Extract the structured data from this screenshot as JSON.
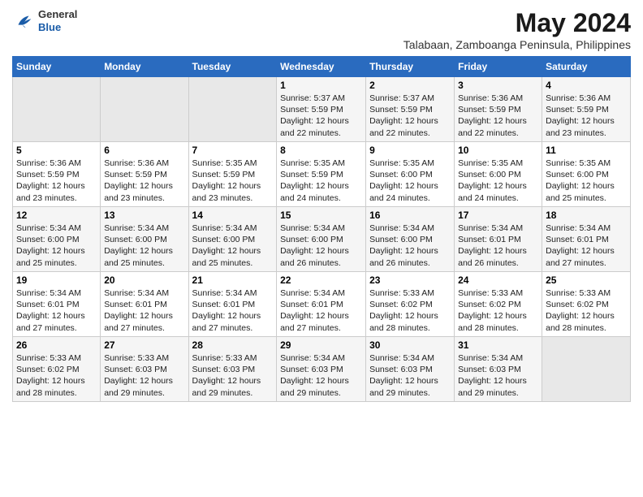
{
  "header": {
    "logo": {
      "line1": "General",
      "line2": "Blue"
    },
    "month_year": "May 2024",
    "location": "Talabaan, Zamboanga Peninsula, Philippines"
  },
  "days_of_week": [
    "Sunday",
    "Monday",
    "Tuesday",
    "Wednesday",
    "Thursday",
    "Friday",
    "Saturday"
  ],
  "weeks": [
    [
      {
        "day": "",
        "content": ""
      },
      {
        "day": "",
        "content": ""
      },
      {
        "day": "",
        "content": ""
      },
      {
        "day": "1",
        "content": "Sunrise: 5:37 AM\nSunset: 5:59 PM\nDaylight: 12 hours\nand 22 minutes."
      },
      {
        "day": "2",
        "content": "Sunrise: 5:37 AM\nSunset: 5:59 PM\nDaylight: 12 hours\nand 22 minutes."
      },
      {
        "day": "3",
        "content": "Sunrise: 5:36 AM\nSunset: 5:59 PM\nDaylight: 12 hours\nand 22 minutes."
      },
      {
        "day": "4",
        "content": "Sunrise: 5:36 AM\nSunset: 5:59 PM\nDaylight: 12 hours\nand 23 minutes."
      }
    ],
    [
      {
        "day": "5",
        "content": "Sunrise: 5:36 AM\nSunset: 5:59 PM\nDaylight: 12 hours\nand 23 minutes."
      },
      {
        "day": "6",
        "content": "Sunrise: 5:36 AM\nSunset: 5:59 PM\nDaylight: 12 hours\nand 23 minutes."
      },
      {
        "day": "7",
        "content": "Sunrise: 5:35 AM\nSunset: 5:59 PM\nDaylight: 12 hours\nand 23 minutes."
      },
      {
        "day": "8",
        "content": "Sunrise: 5:35 AM\nSunset: 5:59 PM\nDaylight: 12 hours\nand 24 minutes."
      },
      {
        "day": "9",
        "content": "Sunrise: 5:35 AM\nSunset: 6:00 PM\nDaylight: 12 hours\nand 24 minutes."
      },
      {
        "day": "10",
        "content": "Sunrise: 5:35 AM\nSunset: 6:00 PM\nDaylight: 12 hours\nand 24 minutes."
      },
      {
        "day": "11",
        "content": "Sunrise: 5:35 AM\nSunset: 6:00 PM\nDaylight: 12 hours\nand 25 minutes."
      }
    ],
    [
      {
        "day": "12",
        "content": "Sunrise: 5:34 AM\nSunset: 6:00 PM\nDaylight: 12 hours\nand 25 minutes."
      },
      {
        "day": "13",
        "content": "Sunrise: 5:34 AM\nSunset: 6:00 PM\nDaylight: 12 hours\nand 25 minutes."
      },
      {
        "day": "14",
        "content": "Sunrise: 5:34 AM\nSunset: 6:00 PM\nDaylight: 12 hours\nand 25 minutes."
      },
      {
        "day": "15",
        "content": "Sunrise: 5:34 AM\nSunset: 6:00 PM\nDaylight: 12 hours\nand 26 minutes."
      },
      {
        "day": "16",
        "content": "Sunrise: 5:34 AM\nSunset: 6:00 PM\nDaylight: 12 hours\nand 26 minutes."
      },
      {
        "day": "17",
        "content": "Sunrise: 5:34 AM\nSunset: 6:01 PM\nDaylight: 12 hours\nand 26 minutes."
      },
      {
        "day": "18",
        "content": "Sunrise: 5:34 AM\nSunset: 6:01 PM\nDaylight: 12 hours\nand 27 minutes."
      }
    ],
    [
      {
        "day": "19",
        "content": "Sunrise: 5:34 AM\nSunset: 6:01 PM\nDaylight: 12 hours\nand 27 minutes."
      },
      {
        "day": "20",
        "content": "Sunrise: 5:34 AM\nSunset: 6:01 PM\nDaylight: 12 hours\nand 27 minutes."
      },
      {
        "day": "21",
        "content": "Sunrise: 5:34 AM\nSunset: 6:01 PM\nDaylight: 12 hours\nand 27 minutes."
      },
      {
        "day": "22",
        "content": "Sunrise: 5:34 AM\nSunset: 6:01 PM\nDaylight: 12 hours\nand 27 minutes."
      },
      {
        "day": "23",
        "content": "Sunrise: 5:33 AM\nSunset: 6:02 PM\nDaylight: 12 hours\nand 28 minutes."
      },
      {
        "day": "24",
        "content": "Sunrise: 5:33 AM\nSunset: 6:02 PM\nDaylight: 12 hours\nand 28 minutes."
      },
      {
        "day": "25",
        "content": "Sunrise: 5:33 AM\nSunset: 6:02 PM\nDaylight: 12 hours\nand 28 minutes."
      }
    ],
    [
      {
        "day": "26",
        "content": "Sunrise: 5:33 AM\nSunset: 6:02 PM\nDaylight: 12 hours\nand 28 minutes."
      },
      {
        "day": "27",
        "content": "Sunrise: 5:33 AM\nSunset: 6:03 PM\nDaylight: 12 hours\nand 29 minutes."
      },
      {
        "day": "28",
        "content": "Sunrise: 5:33 AM\nSunset: 6:03 PM\nDaylight: 12 hours\nand 29 minutes."
      },
      {
        "day": "29",
        "content": "Sunrise: 5:34 AM\nSunset: 6:03 PM\nDaylight: 12 hours\nand 29 minutes."
      },
      {
        "day": "30",
        "content": "Sunrise: 5:34 AM\nSunset: 6:03 PM\nDaylight: 12 hours\nand 29 minutes."
      },
      {
        "day": "31",
        "content": "Sunrise: 5:34 AM\nSunset: 6:03 PM\nDaylight: 12 hours\nand 29 minutes."
      },
      {
        "day": "",
        "content": ""
      }
    ]
  ]
}
